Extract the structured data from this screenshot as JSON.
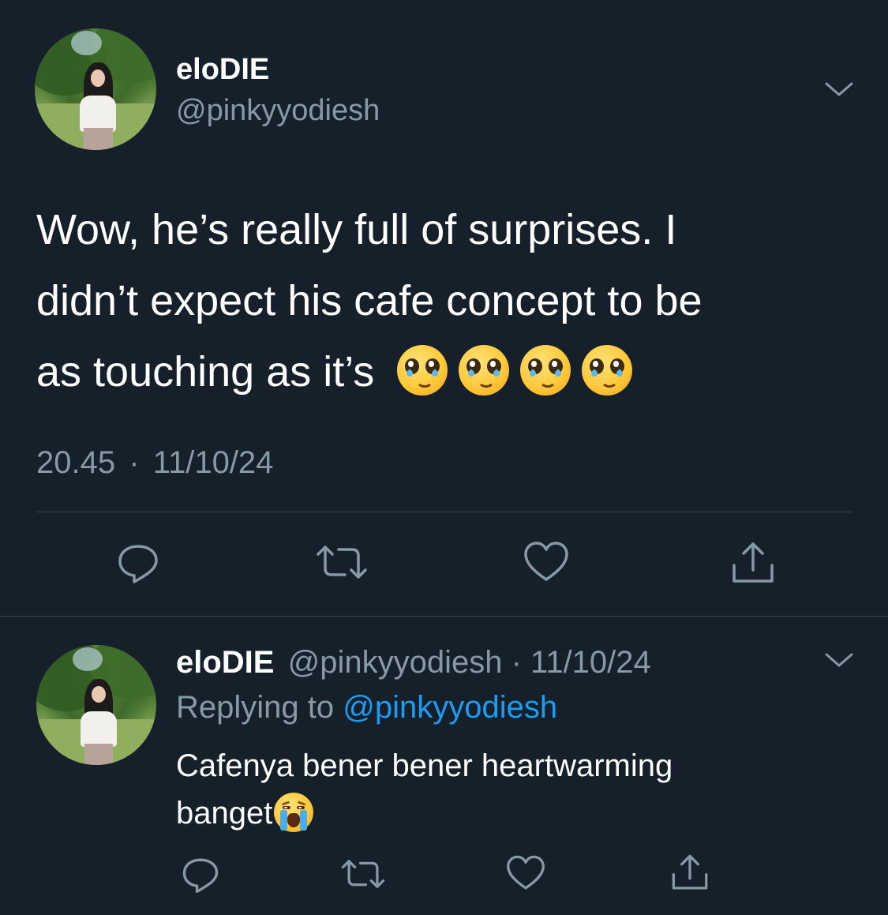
{
  "main_tweet": {
    "display_name": "eloDIE",
    "handle": "@pinkyyodiesh",
    "text_line1": "Wow, he’s really full of surprises. I",
    "text_line2": "didn’t expect his cafe concept to be",
    "text_line3": "as touching as it’s",
    "emoji_count": 4,
    "emoji_name": "pleading-face",
    "time": "20.45",
    "separator": "·",
    "date": "11/10/24"
  },
  "reply_tweet": {
    "display_name": "eloDIE",
    "handle": "@pinkyyodiesh",
    "separator": "·",
    "date": "11/10/24",
    "replying_prefix": "Replying to",
    "replying_handle": "@pinkyyodiesh",
    "text_line1": "Cafenya bener bener heartwarming",
    "text_line2": "banget",
    "emoji_name": "loudly-crying-face"
  },
  "actions": [
    "reply",
    "retweet",
    "like",
    "share"
  ],
  "colors": {
    "background": "#15202b",
    "text": "#ffffff",
    "muted": "#8899a6",
    "link": "#1d9bf0",
    "divider": "#38444d"
  }
}
